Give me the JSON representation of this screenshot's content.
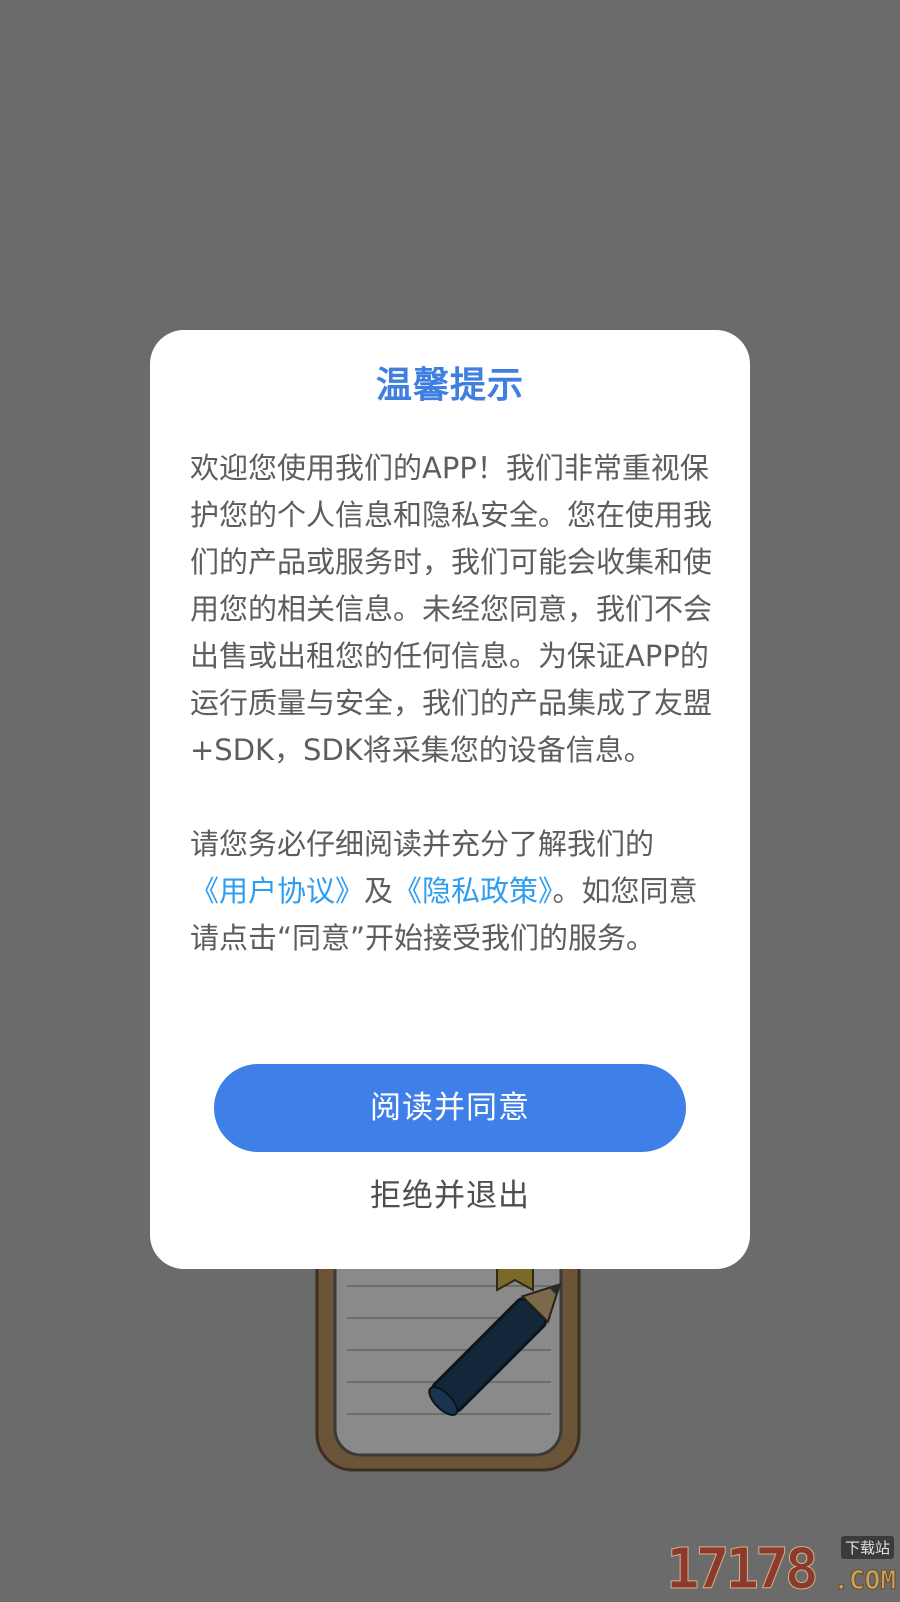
{
  "dialog": {
    "title": "温馨提示",
    "paragraph1": "欢迎您使用我们的APP！我们非常重视保护您的个人信息和隐私安全。您在使用我们的产品或服务时，我们可能会收集和使用您的相关信息。未经您同意，我们不会出售或出租您的任何信息。为保证APP的运行质量与安全，我们的产品集成了友盟+SDK，SDK将采集您的设备信息。",
    "paragraph2_prefix": "请您务必仔细阅读并充分了解我们的",
    "user_agreement_link": "《用户协议》",
    "and_text": "及",
    "privacy_policy_link": "《隐私政策》",
    "paragraph2_suffix": "。如您同意请点击“同意”开始接受我们的服务。",
    "agree_button": "阅读并同意",
    "reject_button": "拒绝并退出"
  },
  "watermark": {
    "number": "17178",
    "tag": "下载站",
    "suffix": ".COM"
  },
  "colors": {
    "overlay_background": "#6b6b6b",
    "title_blue": "#3e7fe0",
    "link_blue": "#2f9df0",
    "button_blue": "#3f80e8",
    "body_text": "#5d5d5d"
  }
}
